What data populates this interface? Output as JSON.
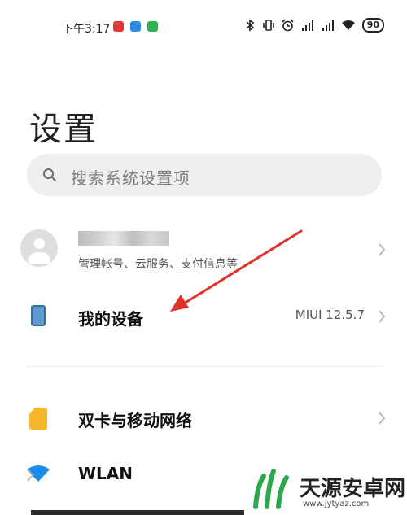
{
  "status_bar": {
    "time": "下午3:17",
    "app_badges": [
      {
        "icon": "app-badge-red",
        "color": "#e53935"
      },
      {
        "icon": "app-badge-blue",
        "color": "#2f8de4"
      },
      {
        "icon": "wechat-badge",
        "color": "#2fb24f"
      }
    ],
    "battery": "90",
    "icons": [
      "bluetooth-icon",
      "vibrate-icon",
      "alarm-icon",
      "signal-icon",
      "signal-icon",
      "wifi-icon",
      "battery-icon"
    ]
  },
  "page": {
    "title": "设置"
  },
  "search": {
    "placeholder": "搜索系统设置项",
    "icon": "search-icon"
  },
  "account": {
    "subtitle": "管理帐号、云服务、支付信息等",
    "avatar_icon": "avatar-icon"
  },
  "device": {
    "label": "我的设备",
    "value": "MIUI 12.5.7",
    "icon": "phone-icon"
  },
  "items": [
    {
      "label": "双卡与移动网络",
      "icon": "sim-card-icon",
      "color": "#f4b72e"
    },
    {
      "label": "WLAN",
      "icon": "wifi-icon",
      "color": "#1a8de8"
    }
  ],
  "annotation": {
    "arrow_color": "#e0322b"
  },
  "watermark": {
    "text": "天源安卓网",
    "url": "www.jytyaz.com",
    "logo_color": "#2ca84a"
  }
}
